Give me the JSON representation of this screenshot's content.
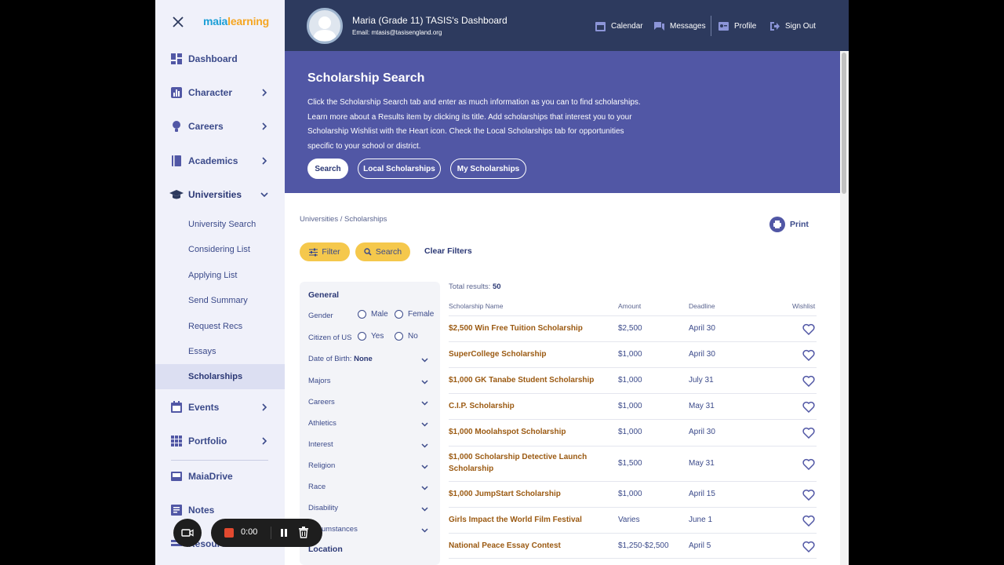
{
  "sidebar": {
    "logo_a": "maia",
    "logo_b": "learning",
    "items": [
      {
        "label": "Dashboard",
        "icon": "dashboard-icon"
      },
      {
        "label": "Character",
        "icon": "chart-icon"
      },
      {
        "label": "Careers",
        "icon": "lightbulb-icon"
      },
      {
        "label": "Academics",
        "icon": "book-icon"
      },
      {
        "label": "Universities",
        "icon": "graduation-cap-icon"
      }
    ],
    "sub_items": [
      "University Search",
      "Considering List",
      "Applying List",
      "Send Summary",
      "Request Recs",
      "Essays",
      "Scholarships"
    ],
    "active_sub": "Scholarships",
    "items2": [
      {
        "label": "Events",
        "icon": "calendar-icon"
      },
      {
        "label": "Portfolio",
        "icon": "grid-icon"
      },
      {
        "label": "MaiaDrive",
        "icon": "drive-icon"
      },
      {
        "label": "Notes",
        "icon": "notes-icon"
      },
      {
        "label": "Resources",
        "icon": "resources-icon"
      }
    ]
  },
  "header": {
    "user_name": "Maria (Grade 11) TASIS's Dashboard",
    "email": "Email: mtasis@tasisengland.org",
    "links": {
      "calendar": "Calendar",
      "messages": "Messages",
      "profile": "Profile",
      "signout": "Sign Out"
    }
  },
  "banner": {
    "title": "Scholarship Search",
    "description": "Click the Scholarship Search tab and enter as much information as you can to find scholarships. Learn more about a Results item by clicking its title. Add scholarships that interest you to your Scholarship Wishlist with the Heart icon. Check the Local Scholarships tab for opportunities specific to your school or district.",
    "tabs": [
      "Search",
      "Local Scholarships",
      "My Scholarships"
    ]
  },
  "breadcrumb": {
    "parent": "Universities",
    "sep": "/",
    "current": "Scholarships"
  },
  "toolbar": {
    "print": "Print",
    "filter": "Filter",
    "search": "Search",
    "clear": "Clear Filters"
  },
  "filters": {
    "general": "General",
    "gender_label": "Gender",
    "gender_options": [
      "Male",
      "Female"
    ],
    "citizen_label": "Citizen of US",
    "citizen_options": [
      "Yes",
      "No"
    ],
    "dob_label": "Date of Birth:",
    "dob_value": "None",
    "dropdowns": [
      "Majors",
      "Careers",
      "Athletics",
      "Interest",
      "Religion",
      "Race",
      "Disability",
      "Circumstances"
    ],
    "location": "Location"
  },
  "results": {
    "total_label": "Total results:",
    "total": "50",
    "columns": [
      "Scholarship Name",
      "Amount",
      "Deadline",
      "Wishlist"
    ],
    "rows": [
      {
        "name": "$2,500 Win Free Tuition Scholarship",
        "amount": "$2,500",
        "deadline": "April 30"
      },
      {
        "name": "SuperCollege Scholarship",
        "amount": "$1,000",
        "deadline": "April 30"
      },
      {
        "name": "$1,000 GK Tanabe Student Scholarship",
        "amount": "$1,000",
        "deadline": "July 31"
      },
      {
        "name": "C.I.P. Scholarship",
        "amount": "$1,000",
        "deadline": "May 31"
      },
      {
        "name": "$1,000 Moolahspot Scholarship",
        "amount": "$1,000",
        "deadline": "April 30"
      },
      {
        "name": "$1,000 Scholarship Detective Launch Scholarship",
        "amount": "$1,500",
        "deadline": "May 31"
      },
      {
        "name": "$1,000 JumpStart Scholarship",
        "amount": "$1,000",
        "deadline": "April 15"
      },
      {
        "name": "Girls Impact the World Film Festival",
        "amount": "Varies",
        "deadline": "June 1"
      },
      {
        "name": "National Peace Essay Contest",
        "amount": "$1,250-$2,500",
        "deadline": "April 5"
      }
    ]
  },
  "recorder": {
    "time": "0:00"
  }
}
